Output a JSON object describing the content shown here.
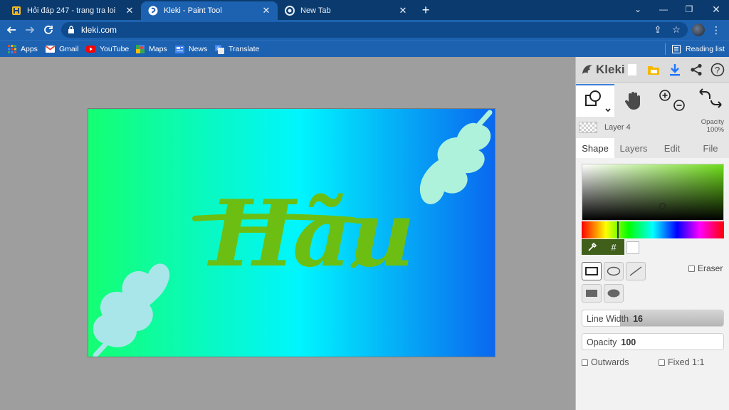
{
  "browser": {
    "tabs": [
      {
        "title": "Hỏi đáp 247 - trang tra loi",
        "active": false
      },
      {
        "title": "Kleki - Paint Tool",
        "active": true
      },
      {
        "title": "New Tab",
        "active": false
      }
    ],
    "url": "kleki.com",
    "bookmarks": [
      {
        "label": "Apps",
        "icon": "apps-icon"
      },
      {
        "label": "Gmail",
        "icon": "gmail-icon"
      },
      {
        "label": "YouTube",
        "icon": "youtube-icon"
      },
      {
        "label": "Maps",
        "icon": "maps-icon"
      },
      {
        "label": "News",
        "icon": "news-icon"
      },
      {
        "label": "Translate",
        "icon": "translate-icon"
      }
    ],
    "reading_list": "Reading list",
    "colors": {
      "frame": "#0b3b6e",
      "toolbar": "#1d62b0"
    }
  },
  "canvas": {
    "text": "Hãu",
    "text_color": "#6cbf12",
    "gradient": [
      "#16ff7a",
      "#00f6ff",
      "#0a6cf0"
    ],
    "leaf_color": "#aef2dc"
  },
  "panel": {
    "logo": "Kleki",
    "layer": {
      "name": "Layer 4",
      "opacity_label": "Opacity",
      "opacity_value": "100%"
    },
    "tabs": [
      {
        "label": "Shape",
        "active": true
      },
      {
        "label": "Layers",
        "active": false
      },
      {
        "label": "Edit",
        "active": false
      },
      {
        "label": "File",
        "active": false
      }
    ],
    "color": {
      "hex_label": "#",
      "primary": "#3f5f1a",
      "secondary": "#ffffff"
    },
    "eraser_label": "Eraser",
    "line_width": {
      "label": "Line Width",
      "value": "16",
      "fill": 0.27
    },
    "opacity": {
      "label": "Opacity",
      "value": "100",
      "fill": 1.0
    },
    "outwards_label": "Outwards",
    "fixed_label": "Fixed 1:1"
  }
}
